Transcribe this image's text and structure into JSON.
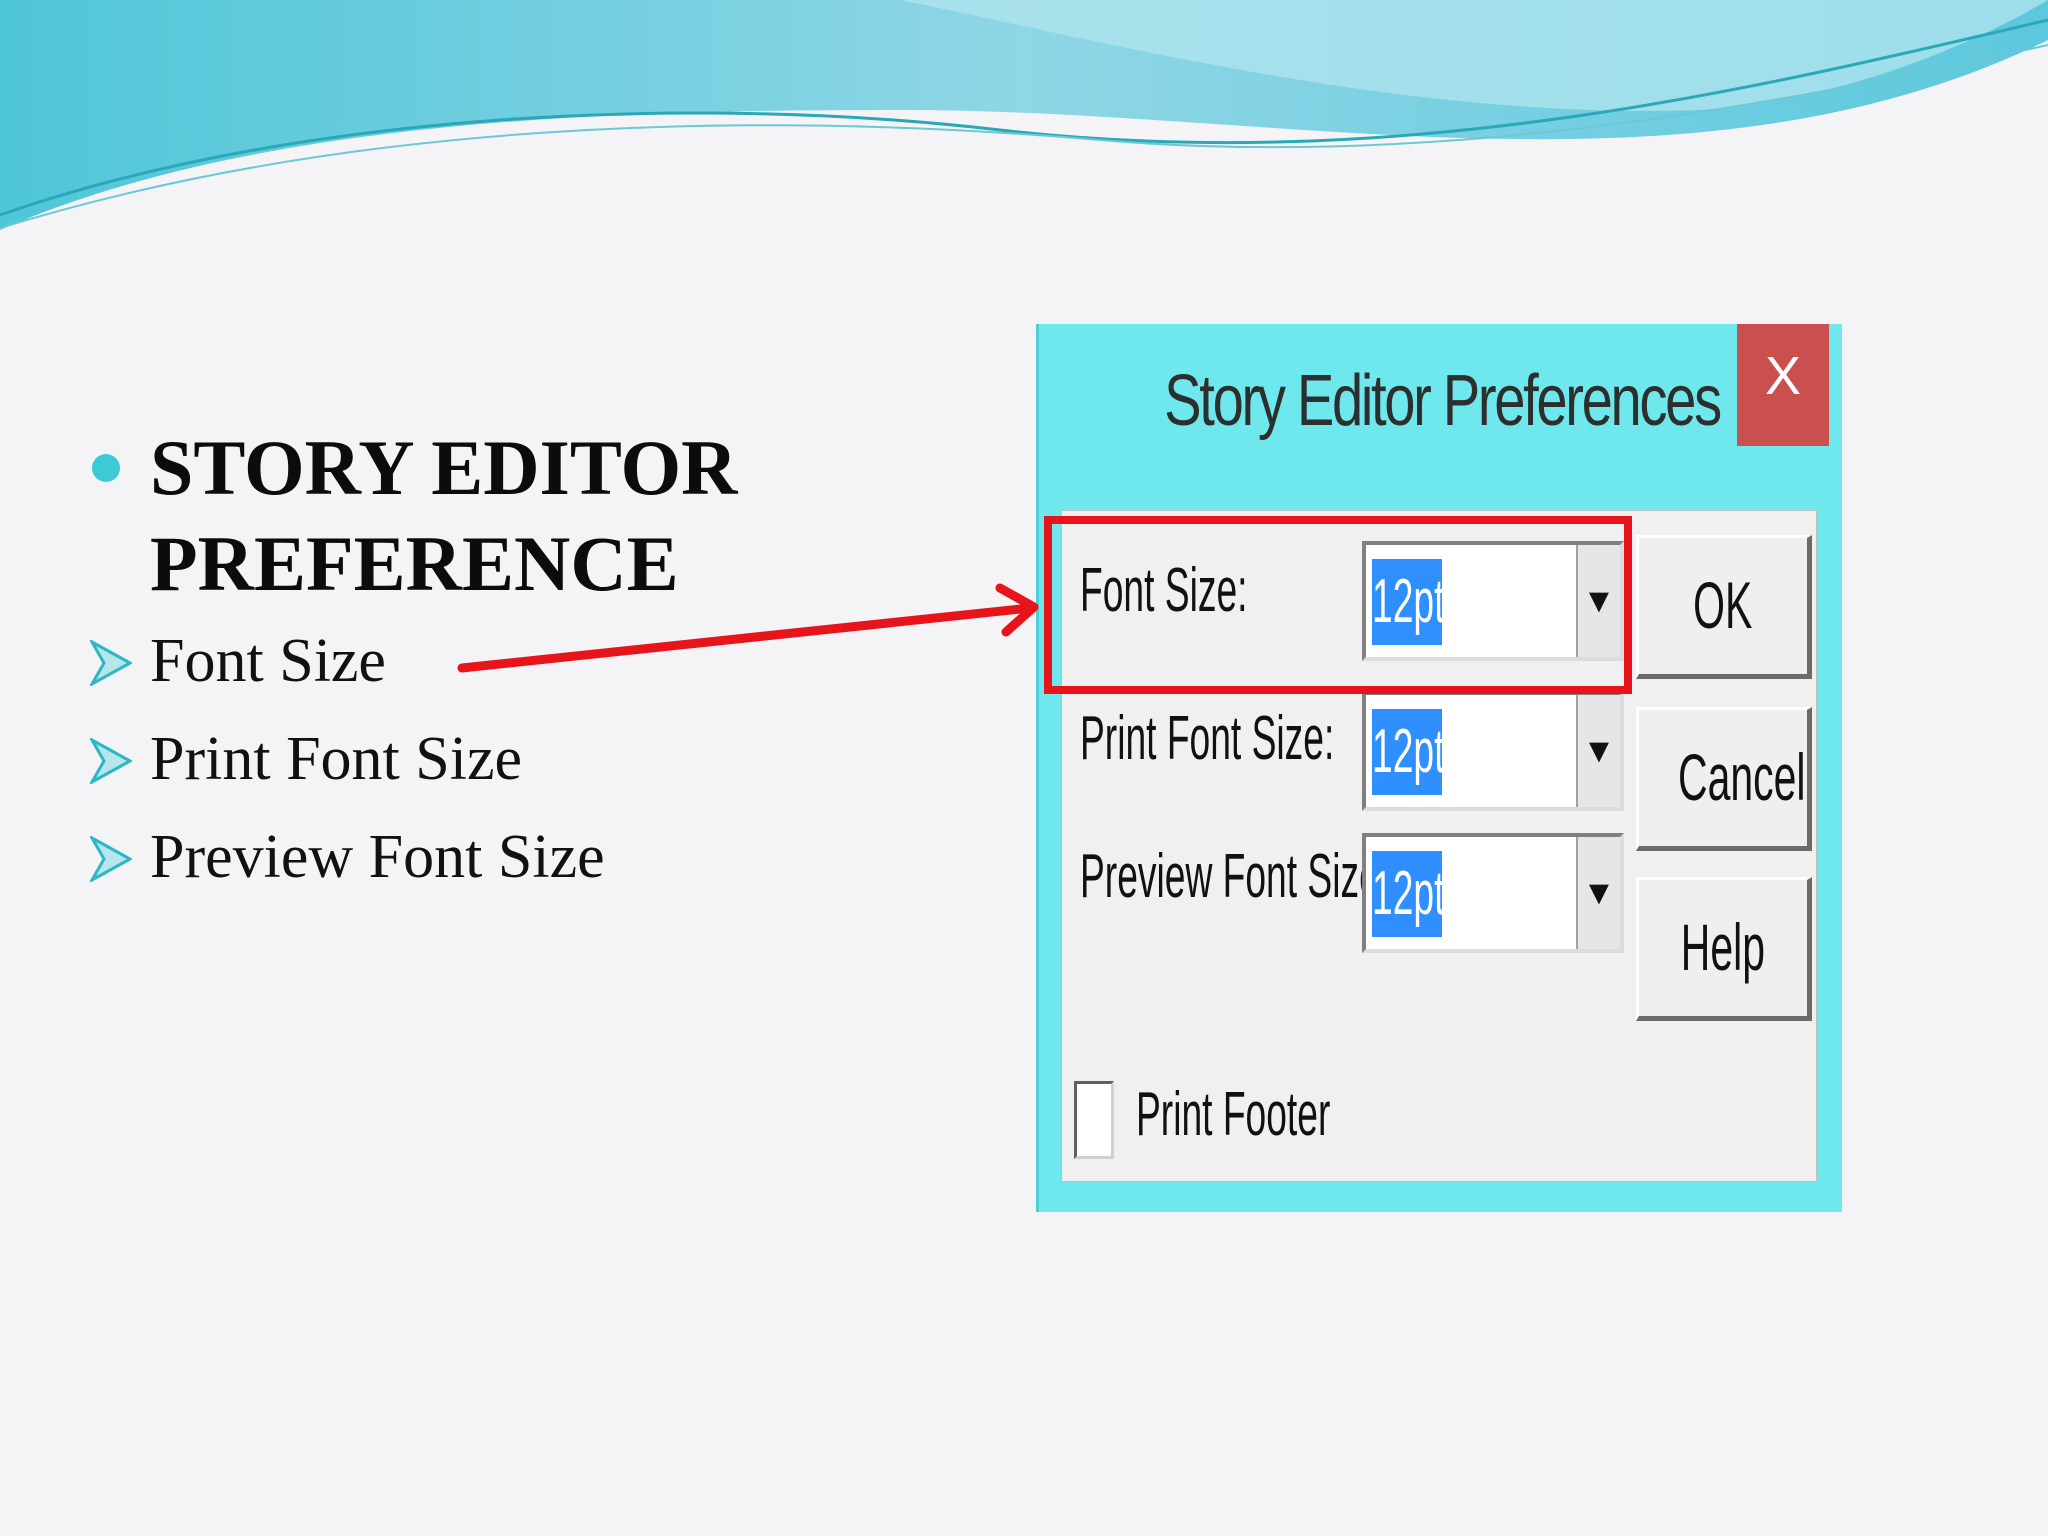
{
  "slide": {
    "bullets": {
      "main": "STORY EDITOR PREFERENCE",
      "sub": [
        "Font Size",
        "Print Font Size",
        "Preview Font Size"
      ]
    }
  },
  "dialog": {
    "title": "Story Editor Preferences",
    "close_label": "X",
    "fields": [
      {
        "label": "Font Size:",
        "value": "12pt"
      },
      {
        "label": "Print Font Size:",
        "value": "12pt"
      },
      {
        "label": "Preview Font Size:",
        "value": "12pt"
      }
    ],
    "buttons": {
      "ok": "OK",
      "cancel": "Cancel",
      "help": "Help"
    },
    "checkbox": {
      "label": "Print Footer",
      "checked": false
    },
    "dropdown_icon": "chevron-down-icon"
  },
  "colors": {
    "accent": "#3ccad6",
    "dialog_background": "#6ee8ec",
    "close_button": "#c9504f",
    "highlight": "#e8141c",
    "selection": "#2f8fff"
  }
}
